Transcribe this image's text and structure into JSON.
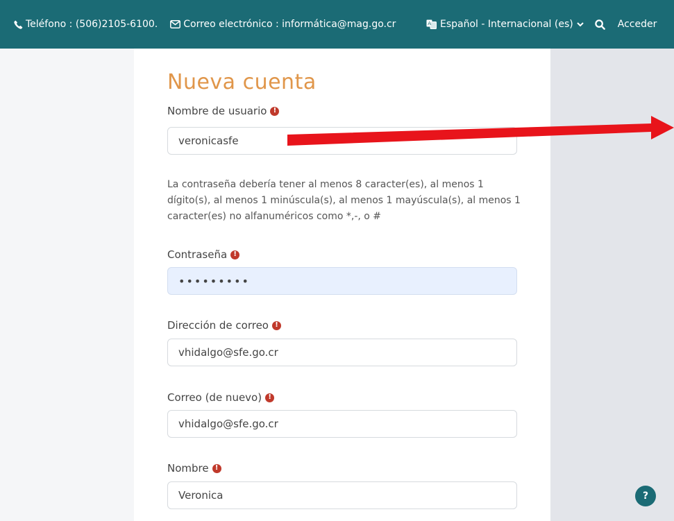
{
  "topbar": {
    "phone": "Teléfono : (506)2105-6100.",
    "email": "Correo electrónico : informática@mag.go.cr",
    "language": "Español - Internacional (es)",
    "login": "Acceder"
  },
  "form": {
    "title": "Nueva cuenta",
    "username_label": "Nombre de usuario",
    "username_value": "veronicasfe",
    "password_policy": "La contraseña debería tener al menos 8 caracter(es), al menos 1 dígito(s), al menos 1 minúscula(s), al menos 1 mayúscula(s), al menos 1 caracter(es) no alfanuméricos como *,-, o #",
    "password_label": "Contraseña",
    "password_value": "•••••••••",
    "email_label": "Dirección de correo",
    "email_value": "vhidalgo@sfe.go.cr",
    "email2_label": "Correo (de nuevo)",
    "email2_value": "vhidalgo@sfe.go.cr",
    "name_label": "Nombre",
    "name_value": "Veronica",
    "required_mark": "!"
  },
  "help": {
    "label": "?"
  },
  "colors": {
    "header_bg": "#1b6b75",
    "title": "#e0964a",
    "required": "#c0392b",
    "autofill_bg": "#e8f0fe",
    "annotation_arrow": "#e8141b"
  },
  "icons": [
    "phone-icon",
    "envelope-icon",
    "language-icon",
    "chevron-down-icon",
    "search-icon",
    "required-icon",
    "help-icon",
    "annotation-arrow"
  ]
}
